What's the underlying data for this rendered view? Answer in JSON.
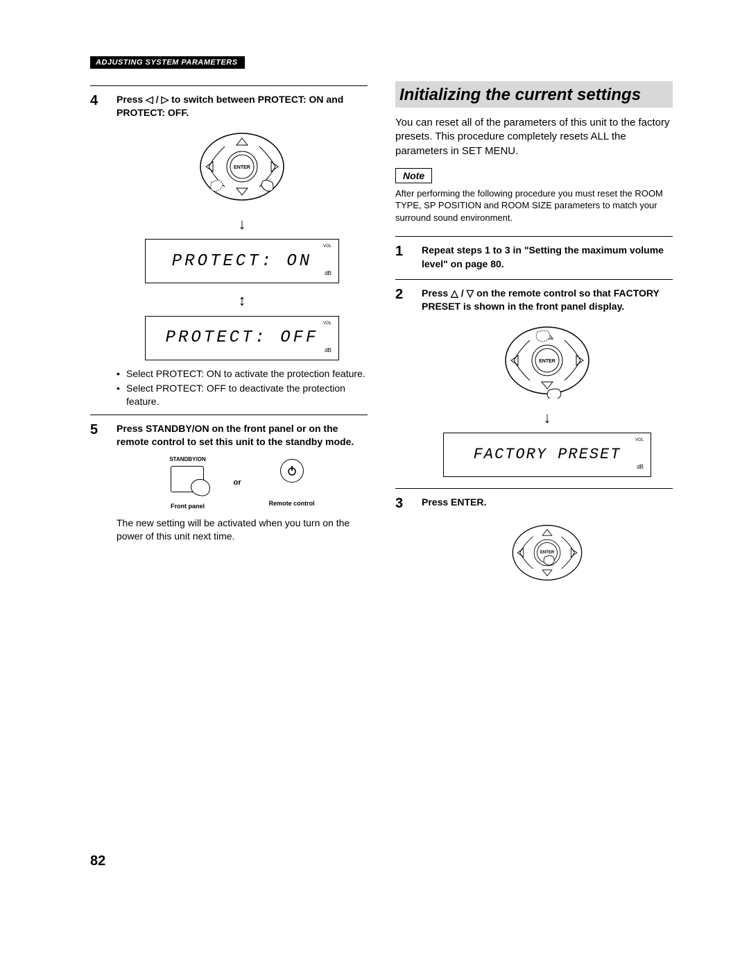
{
  "header": "ADJUSTING SYSTEM PARAMETERS",
  "left": {
    "step4": {
      "num": "4",
      "head_pre": "Press ",
      "head_sym": "◁ / ▷",
      "head_post": " to switch between PROTECT: ON and PROTECT: OFF.",
      "lcd1": "PROTECT: ON",
      "lcd2": "PROTECT: OFF",
      "vol": "VOL",
      "dash": "dB",
      "bullet1": "Select PROTECT: ON to activate the protection feature.",
      "bullet2": "Select PROTECT: OFF to deactivate the protection feature."
    },
    "step5": {
      "num": "5",
      "head": "Press STANDBY/ON on the front panel or on the remote control to set this unit to the standby mode.",
      "standby_label": "STANDBY/ON",
      "front_panel": "Front panel",
      "or": "or",
      "remote_control": "Remote control",
      "body": "The new setting will be activated when you turn on the power of this unit next time."
    }
  },
  "right": {
    "title": "Initializing the current settings",
    "intro": "You can reset all of the parameters of this unit to the factory presets. This procedure completely resets ALL the parameters in SET MENU.",
    "note_label": "Note",
    "note_text": "After performing the following procedure you must reset the ROOM TYPE, SP POSITION and ROOM SIZE parameters to match your surround sound environment.",
    "step1": {
      "num": "1",
      "head": "Repeat steps 1 to 3 in \"Setting the maximum volume level\" on page 80."
    },
    "step2": {
      "num": "2",
      "head_pre": "Press ",
      "head_sym": "△ / ▽",
      "head_post": " on the remote control so that FACTORY PRESET is shown in the front panel display.",
      "lcd": "FACTORY PRESET",
      "vol": "VOL",
      "dash": "dB"
    },
    "step3": {
      "num": "3",
      "head": "Press ENTER."
    },
    "enter_label": "ENTER"
  },
  "page_number": "82"
}
